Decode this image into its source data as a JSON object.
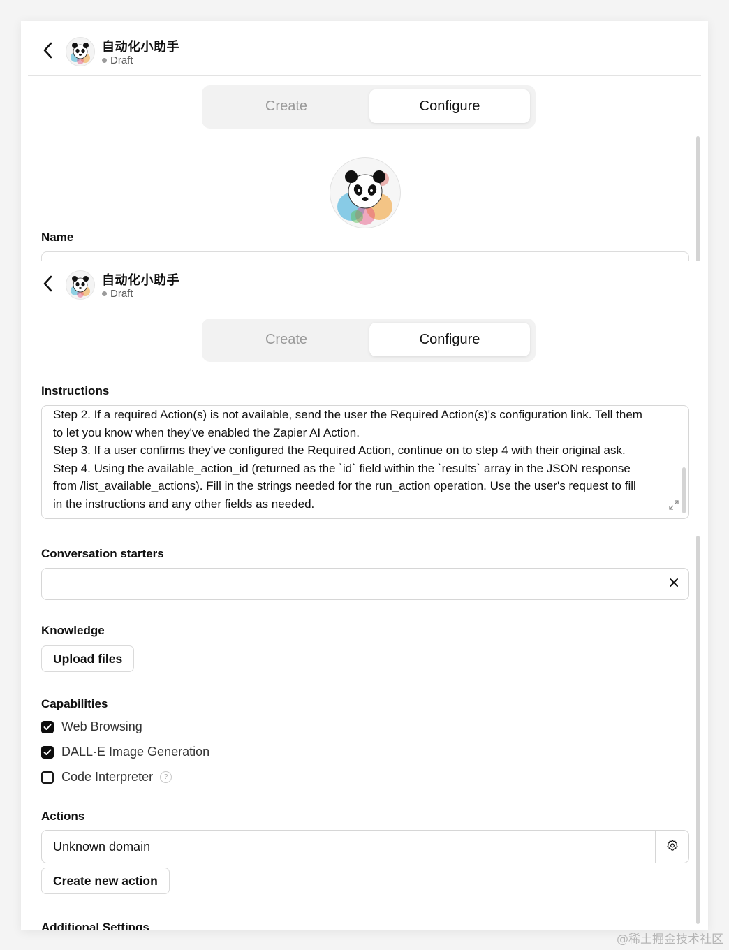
{
  "header": {
    "gpt_name": "自动化小助手",
    "status": "Draft"
  },
  "tabs": {
    "create": "Create",
    "configure": "Configure"
  },
  "fields": {
    "name_label": "Name",
    "instructions_label": "Instructions",
    "instructions_lines": [
      "Step 2. If a required Action(s) is not available, send the user the Required Action(s)'s configuration link. Tell them",
      "to let you know when they've enabled the Zapier AI Action.",
      "Step 3. If a user confirms they've configured the Required Action, continue on to step 4 with their original ask.",
      "Step 4. Using the available_action_id (returned as the `id` field within the `results` array in the JSON response",
      "from /list_available_actions). Fill in the strings needed for the run_action operation. Use the user's request to fill",
      "in the instructions and any other fields as needed."
    ],
    "starters_label": "Conversation starters",
    "starters_value": "",
    "knowledge_label": "Knowledge",
    "upload_button": "Upload files",
    "capabilities_label": "Capabilities",
    "capabilities": [
      {
        "label": "Web Browsing",
        "checked": true
      },
      {
        "label": "DALL·E Image Generation",
        "checked": true
      },
      {
        "label": "Code Interpreter",
        "checked": false,
        "help": "?"
      }
    ],
    "actions_label": "Actions",
    "action_domain": "Unknown domain",
    "create_action_button": "Create new action",
    "cut_off_text": "Additional Settings"
  },
  "watermark": "@稀土掘金技术社区",
  "colors": {
    "accent": "#0d0d0d",
    "border": "#d6d6d6",
    "muted": "#9a9a9a"
  }
}
